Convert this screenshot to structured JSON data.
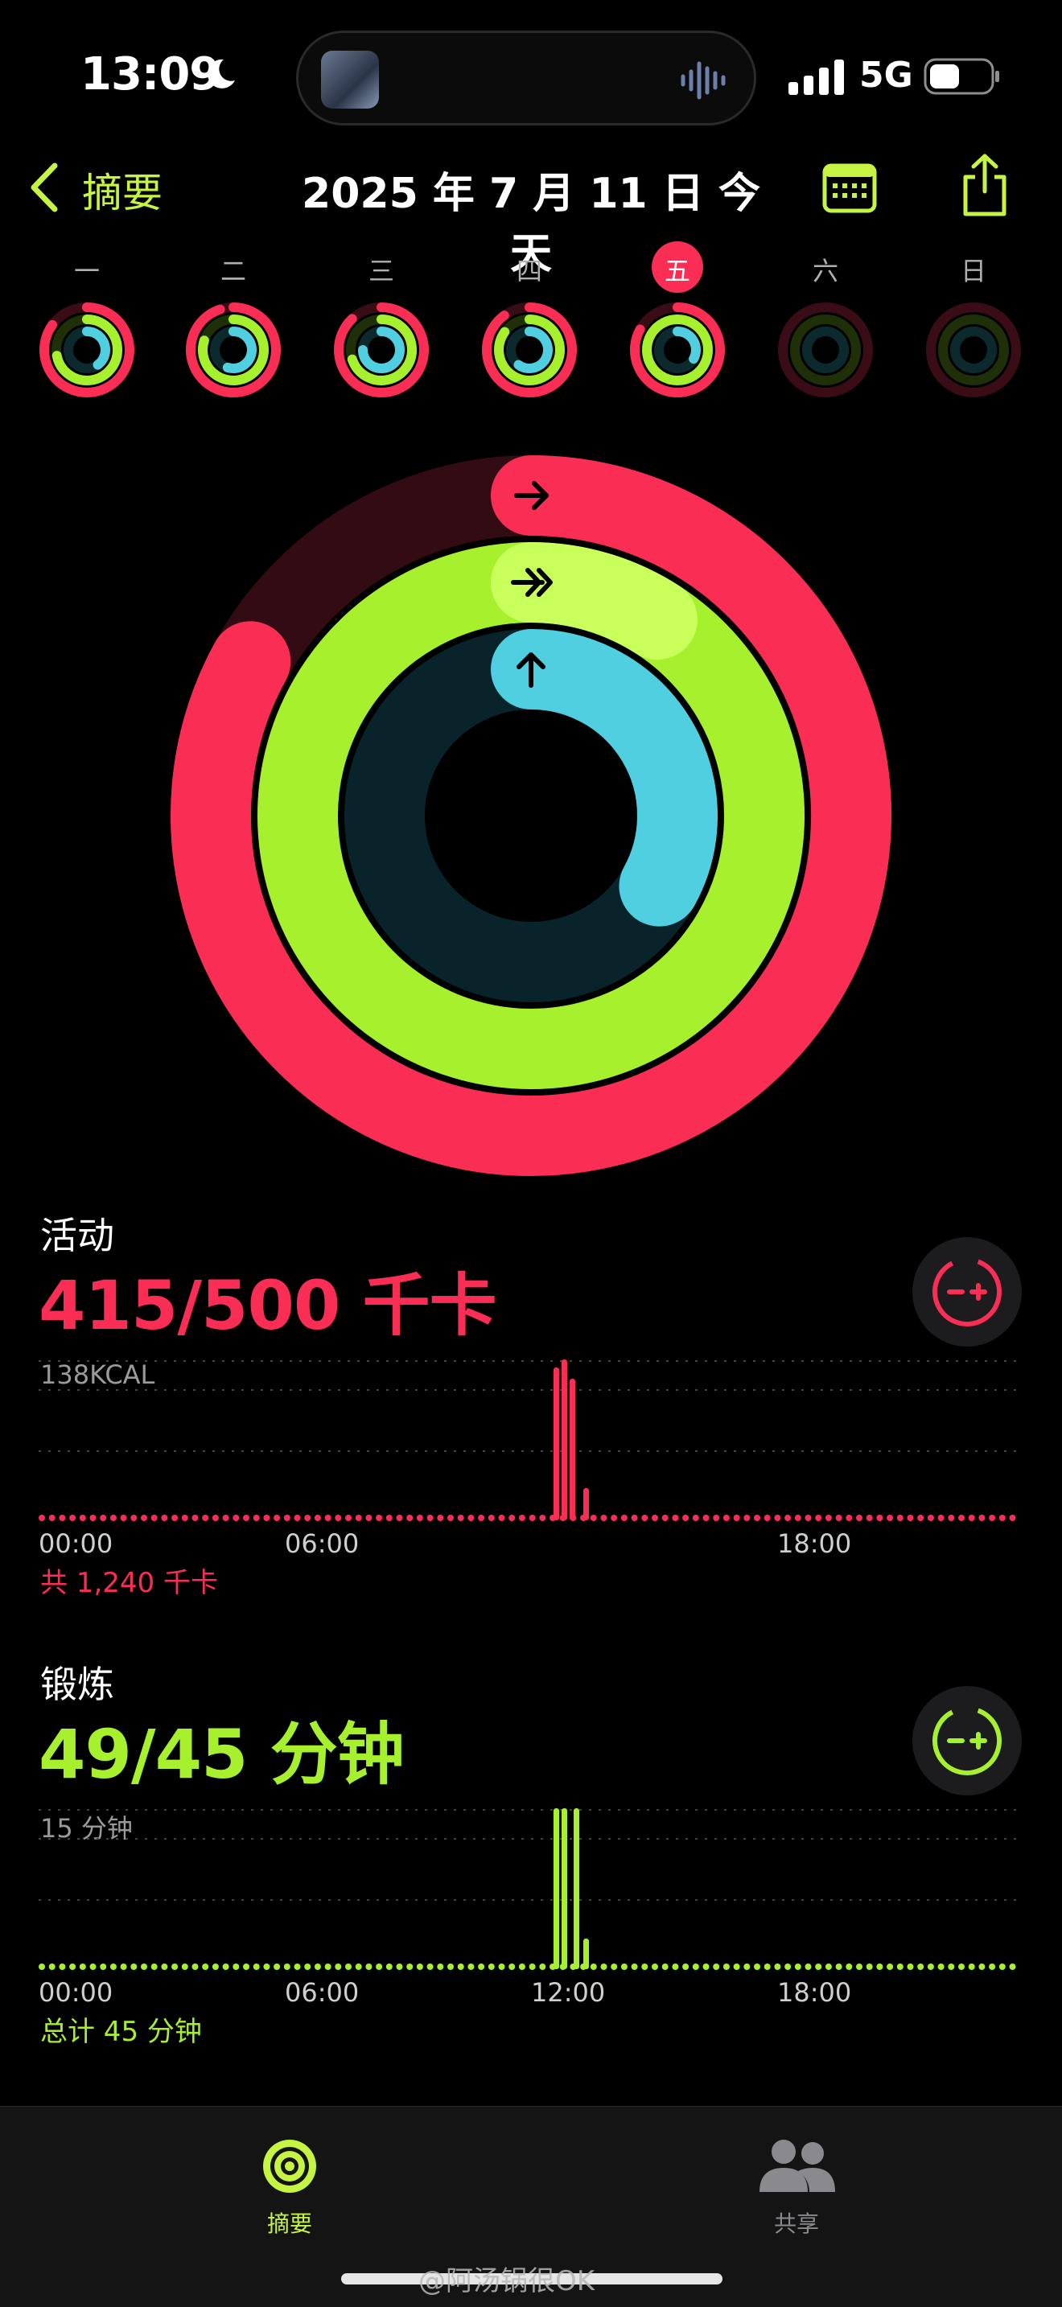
{
  "status_bar": {
    "time": "13:09",
    "network": "5G",
    "icons": [
      "moon-icon",
      "signal-bars-icon",
      "battery-icon",
      "audio-wave-icon"
    ]
  },
  "header": {
    "back_label": "摘要",
    "title": "2025 年 7 月 11 日 今天",
    "icons": [
      "chevron-left-icon",
      "calendar-icon",
      "share-icon"
    ]
  },
  "week": {
    "days": [
      "一",
      "二",
      "三",
      "四",
      "五",
      "六",
      "日"
    ],
    "today_index": 4
  },
  "colors": {
    "move": "#fa2d55",
    "exercise": "#a6f02e",
    "stand": "#4fcfe0",
    "accent": "#c5f542"
  },
  "activity": {
    "title": "活动",
    "value": "415/500 千卡",
    "progress": 0.83,
    "chart_max_label": "138KCAL",
    "x_ticks": [
      "00:00",
      "06:00",
      "18:00"
    ],
    "total": "共 1,240 千卡"
  },
  "exercise": {
    "title": "锻炼",
    "value": "49/45 分钟",
    "progress": 1.09,
    "chart_max_label": "15 分钟",
    "x_ticks": [
      "00:00",
      "06:00",
      "12:00",
      "18:00"
    ],
    "total": "总计 45 分钟"
  },
  "stand_progress": 0.33,
  "tabs": [
    {
      "label": "摘要",
      "icon": "activity-rings-icon",
      "active": true
    },
    {
      "label": "共享",
      "icon": "people-icon",
      "active": false
    }
  ],
  "watermark": "@阿汤锅很OK"
}
